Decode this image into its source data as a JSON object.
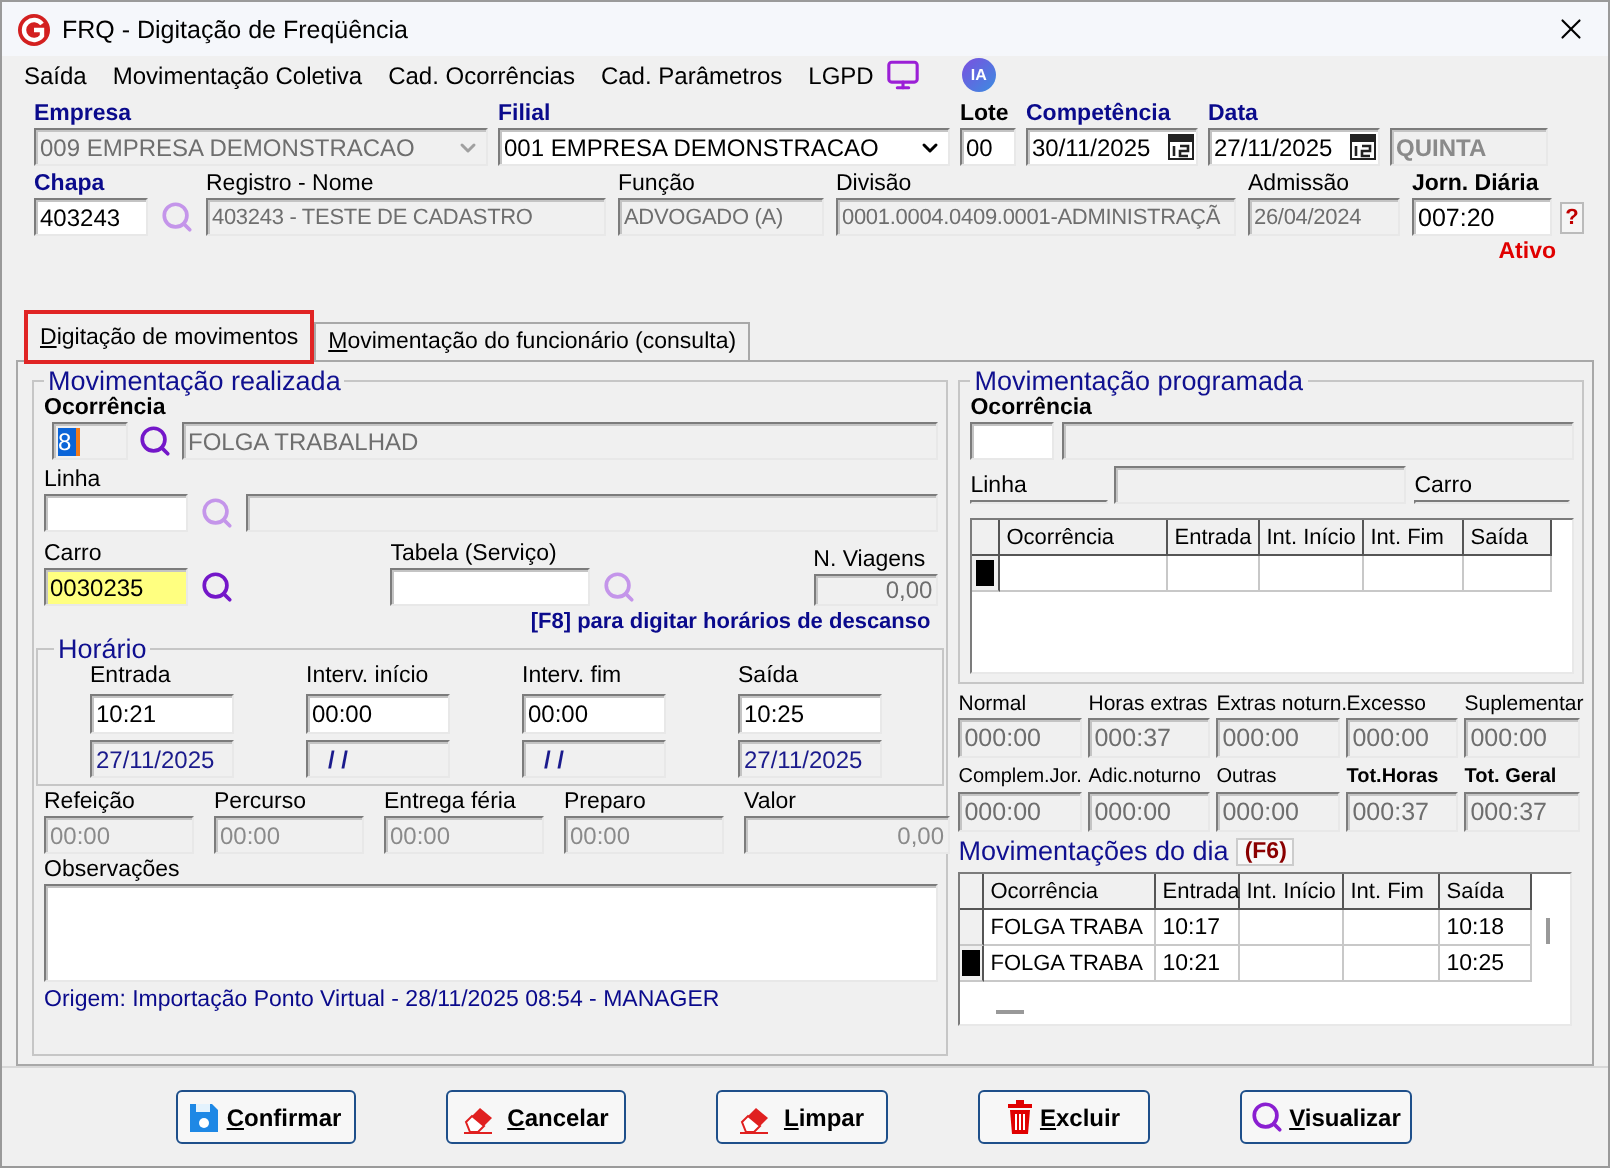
{
  "window": {
    "title": "FRQ - Digitação de Freqüência"
  },
  "menu": [
    {
      "label": "Saída"
    },
    {
      "label": "Movimentação Coletiva"
    },
    {
      "label": "Cad. Ocorrências"
    },
    {
      "label": "Cad. Parâmetros"
    },
    {
      "label": "LGPD"
    }
  ],
  "ai_badge": "IA",
  "header_rows": [
    [
      {
        "label": "Empresa",
        "required": true,
        "kind": "combo",
        "value": "009 EMPRESA DEMONSTRACAO",
        "disabled": true
      },
      {
        "label": "Filial",
        "required": true,
        "kind": "combo",
        "value": "001 EMPRESA DEMONSTRACAO",
        "disabled": false
      },
      {
        "label": "Lote",
        "required": false,
        "label_bold": true,
        "kind": "text",
        "value": "00",
        "disabled": false
      },
      {
        "label": "Competência",
        "required": true,
        "kind": "date",
        "value": "30/11/2025",
        "disabled": false
      },
      {
        "label": "Data",
        "required": true,
        "kind": "date",
        "value": "27/11/2025",
        "disabled": false
      },
      {
        "kind": "weekday",
        "value": "QUINTA",
        "disabled": true
      }
    ],
    [
      {
        "label": "Chapa",
        "required": true,
        "kind": "lookup",
        "value": "403243",
        "disabled": false,
        "icon_active": false
      },
      {
        "label": "Registro - Nome",
        "required": false,
        "label_bold": false,
        "kind": "text",
        "value": "403243 - TESTE DE CADASTRO",
        "disabled": true
      },
      {
        "label": "Função",
        "required": false,
        "label_bold": false,
        "kind": "text",
        "value": "ADVOGADO (A)",
        "disabled": true
      },
      {
        "label": "Divisão",
        "required": false,
        "label_bold": false,
        "kind": "text",
        "value": "0001.0004.0409.0001-ADMINISTRAÇÃ",
        "disabled": true
      },
      {
        "label": "Admissão",
        "required": false,
        "label_bold": false,
        "kind": "text",
        "value": "26/04/2024",
        "disabled": true
      },
      {
        "label": "Jorn. Diária",
        "required": false,
        "label_bold": true,
        "kind": "help",
        "value": "007:20",
        "help": "?",
        "disabled": false
      }
    ]
  ],
  "status": "Ativo",
  "tabs": [
    {
      "label": "Digitação de movimentos",
      "selected": true,
      "highlighted": true
    },
    {
      "label": "Movimentação do funcionário (consulta)",
      "selected": false,
      "highlighted": false
    }
  ],
  "realizada": {
    "title": "Movimentação realizada",
    "ocorrencia": {
      "label": "Ocorrência",
      "code": "8",
      "code_selected": true,
      "description": "FOLGA TRABALHAD",
      "icon_active": true
    },
    "linha": {
      "label": "Linha",
      "icon_active": false
    },
    "carro": {
      "label": "Carro",
      "value": "0030235",
      "focused": true,
      "icon_active": true
    },
    "tabela": {
      "label": "Tabela (Serviço)",
      "icon_active": false
    },
    "viagens": {
      "label": "N. Viagens",
      "value": "0,00"
    },
    "hint": "[F8] para digitar horários de descanso",
    "horario": {
      "title": "Horário",
      "columns": [
        {
          "label": "Entrada",
          "time": "10:21",
          "date": "27/11/2025"
        },
        {
          "label": "Interv. início",
          "time": "00:00",
          "date": "/ /"
        },
        {
          "label": "Interv. fim",
          "time": "00:00",
          "date": "/ /"
        },
        {
          "label": "Saída",
          "time": "10:25",
          "date": "27/11/2025"
        }
      ]
    },
    "extras": [
      {
        "label": "Refeição",
        "value": "00:00",
        "kind": "time"
      },
      {
        "label": "Percurso",
        "value": "00:00",
        "kind": "time"
      },
      {
        "label": "Entrega féria",
        "value": "00:00",
        "kind": "time"
      },
      {
        "label": "Preparo",
        "value": "00:00",
        "kind": "time"
      },
      {
        "label": "Valor",
        "value": "0,00",
        "kind": "amount"
      }
    ],
    "observacoes": {
      "label": "Observações"
    },
    "origem": "Origem: Importação Ponto Virtual - 28/11/2025 08:54 - MANAGER"
  },
  "programada": {
    "title": "Movimentação programada",
    "ocorrencia_label": "Ocorrência",
    "linha_label": "Linha",
    "carro_label": "Carro",
    "columns": [
      "Ocorrência",
      "Entrada",
      "Int. Início",
      "Int. Fim",
      "Saída"
    ]
  },
  "totals": [
    {
      "label": "Normal",
      "value": "000:00",
      "emphasis": false
    },
    {
      "label": "Horas extras",
      "value": "000:37",
      "emphasis": false
    },
    {
      "label": "Extras noturn.",
      "value": "000:00",
      "emphasis": false
    },
    {
      "label": "Excesso",
      "value": "000:00",
      "emphasis": false
    },
    {
      "label": "Suplementar",
      "value": "000:00",
      "emphasis": false
    },
    {
      "label": "Complem.Jor.",
      "value": "000:00",
      "emphasis": false
    },
    {
      "label": "Adic.noturno",
      "value": "000:00",
      "emphasis": false
    },
    {
      "label": "Outras",
      "value": "000:00",
      "emphasis": false
    },
    {
      "label": "Tot.Horas",
      "value": "000:37",
      "emphasis": true
    },
    {
      "label": "Tot. Geral",
      "value": "000:37",
      "emphasis": true
    }
  ],
  "dia": {
    "title": "Movimentações do dia",
    "shortcut": "(F6)",
    "columns": [
      "Ocorrência",
      "Entrada",
      "Int. Início",
      "Int. Fim",
      "Saída"
    ],
    "rows": [
      {
        "ocorrencia": "FOLGA TRABA",
        "entrada": "10:17",
        "saida": "10:18",
        "selected": false
      },
      {
        "ocorrencia": "FOLGA TRABA",
        "entrada": "10:21",
        "saida": "10:25",
        "selected": true
      }
    ]
  },
  "buttons": [
    {
      "label": "Confirmar",
      "kind": "save"
    },
    {
      "label": "Cancelar",
      "kind": "eraser"
    },
    {
      "label": "Limpar",
      "kind": "eraser"
    },
    {
      "label": "Excluir",
      "kind": "delete"
    },
    {
      "label": "Visualizar",
      "kind": "search"
    }
  ]
}
